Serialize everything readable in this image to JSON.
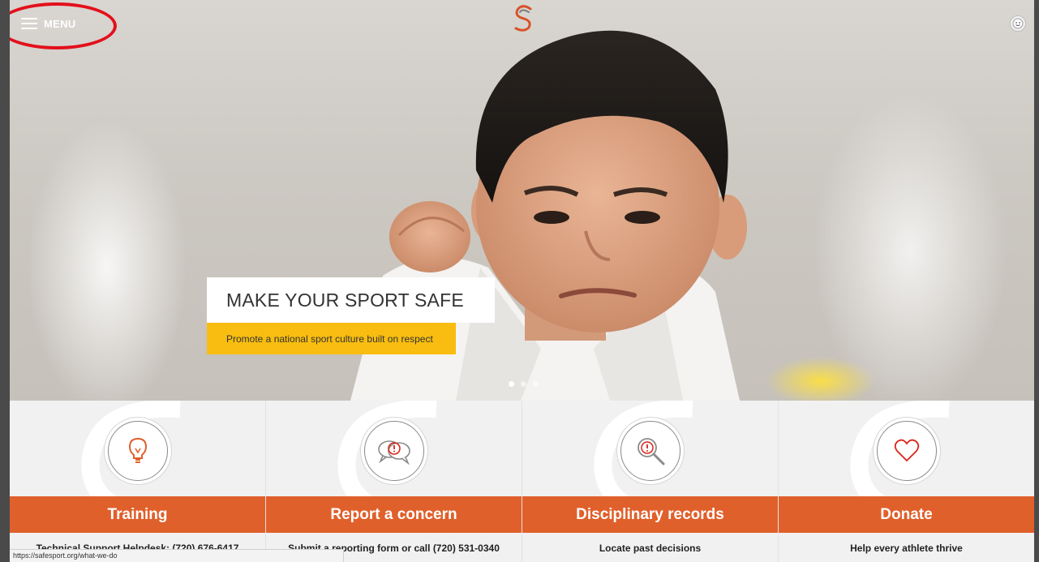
{
  "header": {
    "menu_label": "MENU",
    "logo_icon": "safesport-s-logo-icon",
    "avatar_icon": "user-smiley-icon"
  },
  "hero": {
    "headline": "MAKE YOUR SPORT SAFE",
    "tagline": "Promote a national sport culture built on respect",
    "slides_total": 3,
    "active_slide": 1
  },
  "tiles": [
    {
      "title": "Training",
      "description": "Technical Support Helpdesk: (720) 676-6417",
      "icon": "lightbulb-icon"
    },
    {
      "title": "Report a concern",
      "description": "Submit a reporting form or call (720) 531-0340",
      "icon": "speech-bubbles-alert-icon"
    },
    {
      "title": "Disciplinary records",
      "description": "Locate past decisions",
      "icon": "magnifier-alert-icon"
    },
    {
      "title": "Donate",
      "description": "Help every athlete thrive",
      "icon": "heart-icon"
    }
  ],
  "status_bar": {
    "url": "https://safesport.org/what-we-do"
  },
  "colors": {
    "accent_orange": "#e0602b",
    "cta_yellow": "#f8bd10",
    "highlight_red": "#e3101b"
  }
}
